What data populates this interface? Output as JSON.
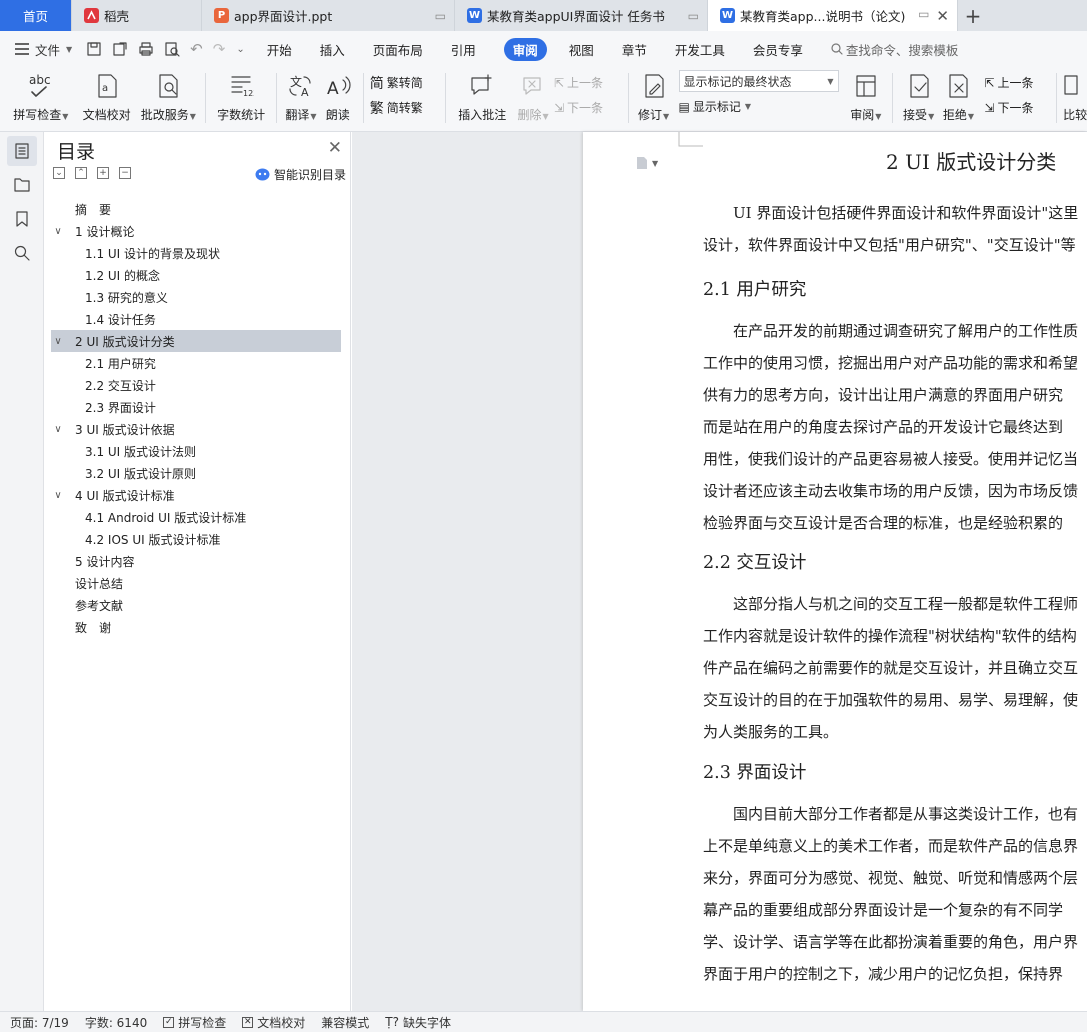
{
  "tabs": [
    {
      "label": "首页",
      "type": "home"
    },
    {
      "label": "稻壳",
      "type": "docer"
    },
    {
      "label": "app界面设计.ppt",
      "type": "ppt"
    },
    {
      "label": "某教育类appUI界面设计 任务书",
      "type": "word"
    },
    {
      "label": "某教育类app...说明书（论文)",
      "type": "word",
      "active": true
    }
  ],
  "menubar": {
    "file": "文件",
    "items": [
      "开始",
      "插入",
      "页面布局",
      "引用",
      "审阅",
      "视图",
      "章节",
      "开发工具",
      "会员专享"
    ],
    "active": "审阅",
    "search_placeholder": "查找命令、搜索模板"
  },
  "ribbon": {
    "spell": "拼写检查",
    "doc_proof": "文档校对",
    "review_service": "批改服务",
    "word_count": "字数统计",
    "translate": "翻译",
    "read_aloud": "朗读",
    "trad_simp": "繁转简",
    "simp_trad": "简转繁",
    "insert_comment": "插入批注",
    "delete": "删除",
    "prev_comment": "上一条",
    "next_comment": "下一条",
    "track": "修订",
    "markup_select": "显示标记的最终状态",
    "show_markup": "显示标记",
    "review": "审阅",
    "accept": "接受",
    "reject": "拒绝",
    "prev_change": "上一条",
    "next_change": "下一条",
    "compare": "比较"
  },
  "toc": {
    "title": "目录",
    "smart": "智能识别目录",
    "items": [
      {
        "label": "摘　要",
        "level": 1,
        "chev": ""
      },
      {
        "label": "1  设计概论",
        "level": 1,
        "chev": "v"
      },
      {
        "label": "1.1 UI 设计的背景及现状",
        "level": 2
      },
      {
        "label": "1.2 UI 的概念",
        "level": 2
      },
      {
        "label": "1.3 研究的意义",
        "level": 2
      },
      {
        "label": "1.4 设计任务",
        "level": 2
      },
      {
        "label": "2 UI 版式设计分类",
        "level": 1,
        "chev": "v",
        "selected": true
      },
      {
        "label": "2.1 用户研究",
        "level": 2
      },
      {
        "label": "2.2  交互设计",
        "level": 2
      },
      {
        "label": "2.3  界面设计",
        "level": 2
      },
      {
        "label": "3 UI 版式设计依据",
        "level": 1,
        "chev": "v"
      },
      {
        "label": "3.1 UI 版式设计法则",
        "level": 2
      },
      {
        "label": "3.2 UI 版式设计原则",
        "level": 2
      },
      {
        "label": "4 UI 版式设计标准",
        "level": 1,
        "chev": "v"
      },
      {
        "label": "4.1 Android UI 版式设计标准",
        "level": 2
      },
      {
        "label": "4.2 IOS UI 版式设计标准",
        "level": 2
      },
      {
        "label": "5  设计内容",
        "level": 1,
        "chev": ""
      },
      {
        "label": "设计总结",
        "level": 1,
        "chev": ""
      },
      {
        "label": "参考文献",
        "level": 1,
        "chev": ""
      },
      {
        "label": "致　谢",
        "level": 1,
        "chev": ""
      }
    ]
  },
  "document": {
    "h1": "2 UI 版式设计分类",
    "intro": [
      "　　UI 界面设计包括硬件界面设计和软件界面设计\"这里",
      "设计，软件界面设计中又包括\"用户研究\"、\"交互设计\"等"
    ],
    "s21": "2.1 用户研究",
    "p21": [
      "　　在产品开发的前期通过调查研究了解用户的工作性质",
      "工作中的使用习惯，挖掘出用户对产品功能的需求和希望",
      "供有力的思考方向，设计出让用户满意的界面用户研究",
      "而是站在用户的角度去探讨产品的开发设计它最终达到",
      "用性，使我们设计的产品更容易被人接受。使用并记忆当",
      "设计者还应该主动去收集市场的用户反馈，因为市场反馈",
      "检验界面与交互设计是否合理的标准，也是经验积累的"
    ],
    "s22": "2.2  交互设计",
    "p22": [
      "　　这部分指人与机之间的交互工程一般都是软件工程师",
      "工作内容就是设计软件的操作流程\"树状结构\"软件的结构",
      "件产品在编码之前需要作的就是交互设计，并且确立交互",
      "交互设计的目的在于加强软件的易用、易学、易理解，使",
      "为人类服务的工具。"
    ],
    "s23": "2.3  界面设计",
    "p23": [
      "　　国内目前大部分工作者都是从事这类设计工作，也有",
      "上不是单纯意义上的美术工作者，而是软件产品的信息界",
      "来分，界面可分为感觉、视觉、触觉、听觉和情感两个层",
      "幕产品的重要组成部分界面设计是一个复杂的有不同学",
      "学、设计学、语言学等在此都扮演着重要的角色，用户界",
      "界面于用户的控制之下，减少用户的记忆负担，保持界"
    ]
  },
  "statusbar": {
    "page": "页面: 7/19",
    "words": "字数: 6140",
    "spell": "拼写检查",
    "proof": "文档校对",
    "compat": "兼容模式",
    "missing_font": "缺失字体"
  }
}
